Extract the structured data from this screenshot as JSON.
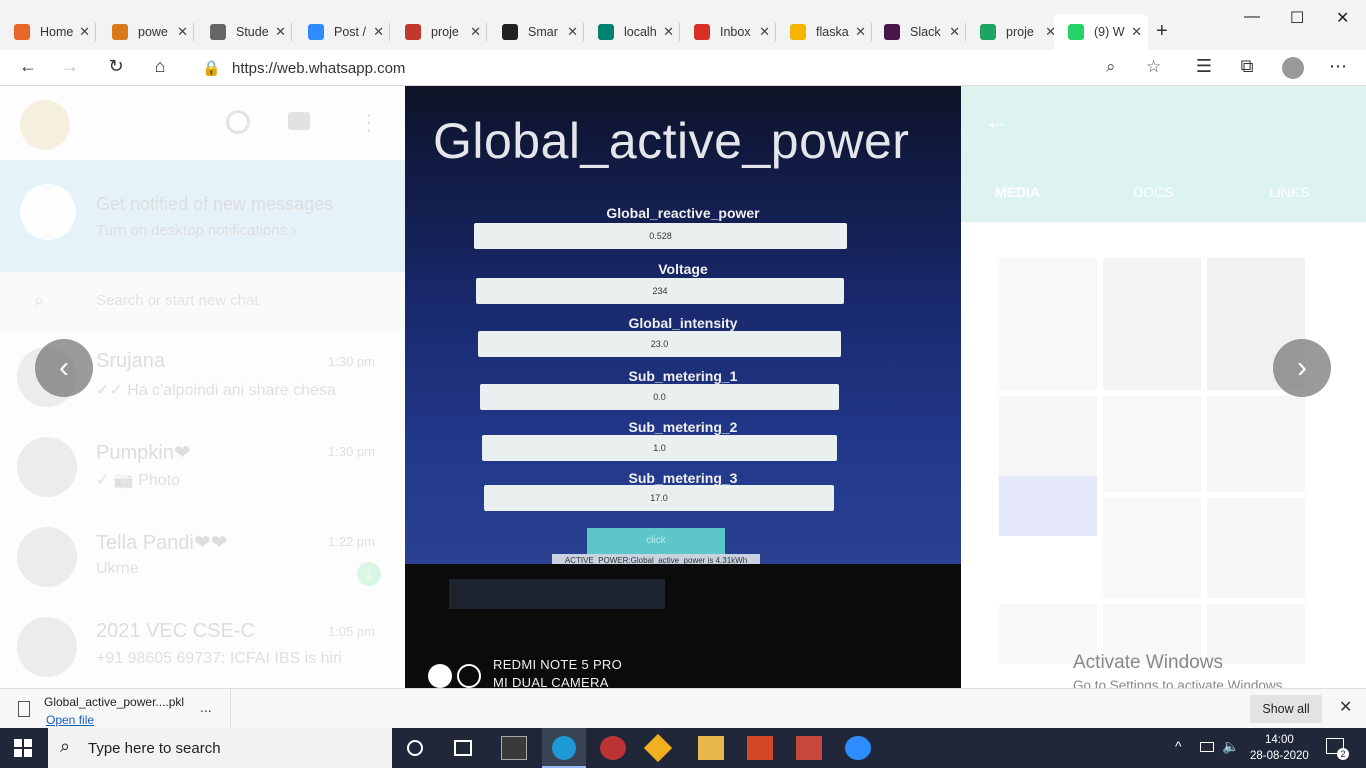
{
  "browser": {
    "tabs": [
      {
        "title": "Home",
        "icon": "circle-arrow-icon",
        "color": "#e8662a"
      },
      {
        "title": "powe",
        "icon": "powerpoint-icon",
        "color": "#d97a1a"
      },
      {
        "title": "Stude",
        "icon": "document-icon",
        "color": "#666666"
      },
      {
        "title": "Post /",
        "icon": "zoom-icon",
        "color": "#2d8cff"
      },
      {
        "title": "proje",
        "icon": "pdf-icon",
        "color": "#c0392b"
      },
      {
        "title": "Smar",
        "icon": "github-icon",
        "color": "#222222"
      },
      {
        "title": "localh",
        "icon": "bing-icon",
        "color": "#008373"
      },
      {
        "title": "Inbox",
        "icon": "gmail-icon",
        "color": "#d93025"
      },
      {
        "title": "flaska",
        "icon": "drive-icon",
        "color": "#f4b400"
      },
      {
        "title": "Slack",
        "icon": "slack-icon",
        "color": "#4a154b"
      },
      {
        "title": "proje",
        "icon": "drive-icon",
        "color": "#1fa463"
      },
      {
        "title": "(9) W",
        "icon": "whatsapp-icon",
        "color": "#25d366"
      }
    ],
    "new_tab": "+",
    "url": "https://web.whatsapp.com"
  },
  "whatsapp": {
    "banner_title": "Get notified of new messages",
    "banner_sub": "Turn on desktop notifications ›",
    "search_placeholder": "Search or start new chat",
    "chats": [
      {
        "name": "Srujana",
        "time": "1:30 pm",
        "message": "✓✓ Ha c'alpoindi ani share chesa"
      },
      {
        "name": "Pumpkin❤",
        "time": "1:30 pm",
        "message": "✓ 📷 Photo"
      },
      {
        "name": "Tella Pandi❤❤",
        "time": "1:22 pm",
        "message": "Ukrne",
        "unread": "1"
      },
      {
        "name": "2021 VEC CSE-C",
        "time": "1:05 pm",
        "message": "+91 98605 69737: ICFAI IBS is hiri"
      }
    ],
    "media_tabs": [
      "MEDIA",
      "DOCS",
      "LINKS"
    ]
  },
  "photo": {
    "title": "Global_active_power",
    "fields": [
      {
        "label": "Global_reactive_power",
        "value": "0.528"
      },
      {
        "label": "Voltage",
        "value": "234"
      },
      {
        "label": "Global_intensity",
        "value": "23.0"
      },
      {
        "label": "Sub_metering_1",
        "value": "0.0"
      },
      {
        "label": "Sub_metering_2",
        "value": "1.0"
      },
      {
        "label": "Sub_metering_3",
        "value": "17.0"
      }
    ],
    "button": "click",
    "result": "ACTIVE_POWER:Global_active_power is 4.31kWh",
    "camera_line1": "REDMI NOTE 5 PRO",
    "camera_line2": "MI DUAL CAMERA"
  },
  "activation": {
    "line1": "Activate Windows",
    "line2": "Go to Settings to activate Windows."
  },
  "downloads": {
    "file_name": "Global_active_power....pkl",
    "open_label": "Open file",
    "more_label": "...",
    "show_all": "Show all"
  },
  "taskbar": {
    "search_placeholder": "Type here to search",
    "time": "14:00",
    "date": "28-08-2020",
    "notifications": "2"
  }
}
